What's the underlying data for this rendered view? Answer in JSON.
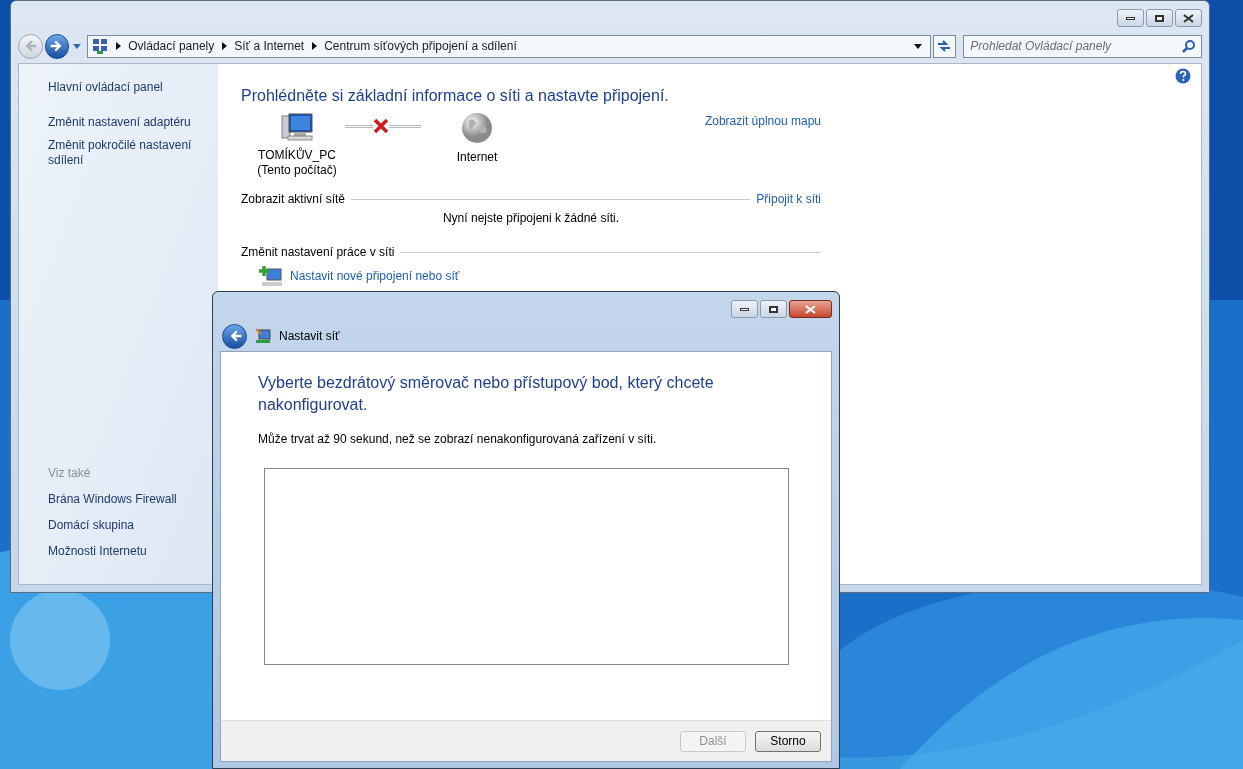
{
  "explorer": {
    "nav_buttons": [
      {
        "kind": "back",
        "disabled": true
      },
      {
        "kind": "forward",
        "disabled": false
      }
    ],
    "breadcrumbs": [
      "Ovládací panely",
      "Síť a Internet",
      "Centrum síťových připojení a sdílení"
    ],
    "search": {
      "placeholder": "Prohledat Ovládací panely"
    },
    "sidebar": {
      "links": [
        "Hlavní ovládací panel",
        "Změnit nastavení adaptéru",
        "Změnit pokročilé nastavení sdílení"
      ],
      "see_also_title": "Viz také",
      "see_also": [
        "Brána Windows Firewall",
        "Domácí skupina",
        "Možnosti Internetu"
      ]
    },
    "main": {
      "heading": "Prohlédněte si základní informace o síti a nastavte připojení.",
      "map_link": "Zobrazit úplnou mapu",
      "connected": false,
      "nodes": [
        {
          "kind": "computer",
          "label": "TOMÍKŮV_PC",
          "sublabel": "(Tento počítač)"
        },
        {
          "kind": "internet",
          "label": "Internet"
        }
      ],
      "active_section": {
        "title": "Zobrazit aktivní sítě",
        "link": "Připojit k síti",
        "message": "Nyní nejste připojeni k žádné síti."
      },
      "settings_section": {
        "title": "Změnit nastavení práce v síti"
      },
      "tasks": [
        {
          "label": "Nastavit nové připojení nebo síť"
        }
      ]
    }
  },
  "dialog": {
    "title": "Nastavit síť",
    "heading": "Vyberte bezdrátový směrovač nebo přístupový bod, který chcete nakonfigurovat.",
    "note": "Může trvat až 90 sekund, než se zobrazí nenakonfigurovaná zařízení v síti.",
    "buttons": [
      {
        "label": "Další",
        "disabled": true
      },
      {
        "label": "Storno",
        "disabled": false
      }
    ]
  }
}
